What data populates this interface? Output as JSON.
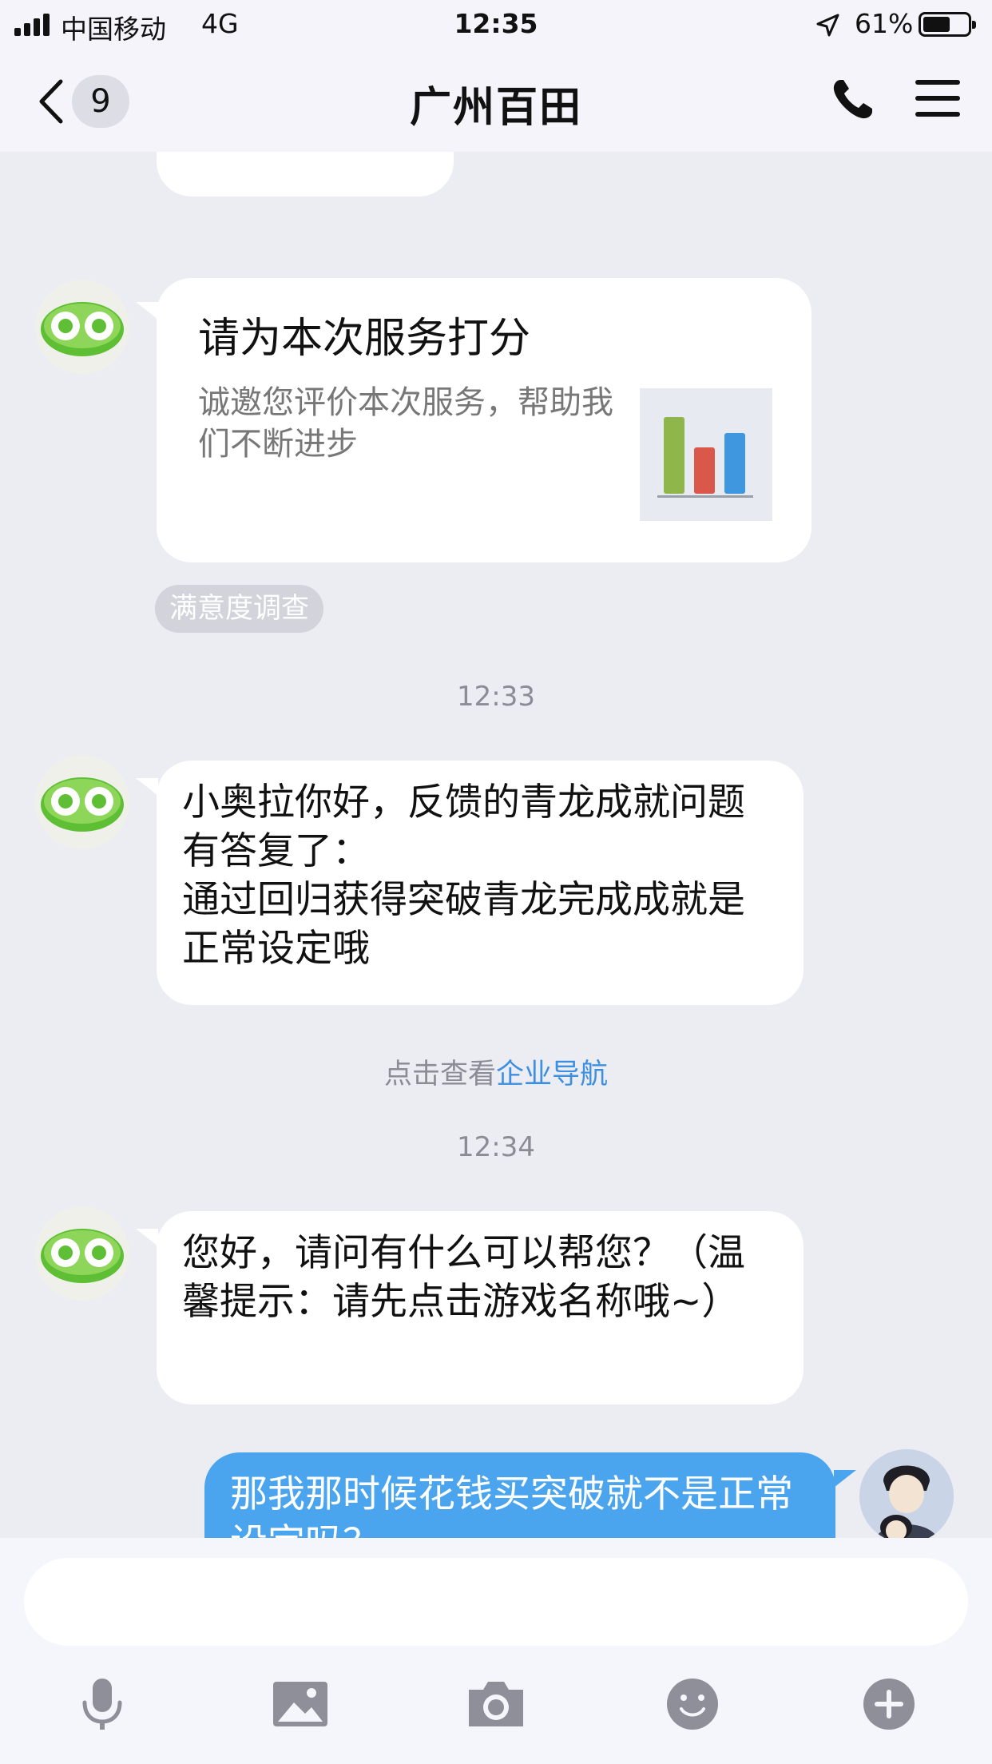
{
  "status_bar": {
    "carrier": "中国移动",
    "network": "4G",
    "time": "12:35",
    "battery_percent": "61%",
    "battery_level": 0.61,
    "signal_bars": 4
  },
  "nav": {
    "unread_count": "9",
    "title": "广州百田",
    "icons": [
      "back-chevron-icon",
      "phone-icon",
      "menu-icon"
    ]
  },
  "messages": {
    "rating_card": {
      "title": "请为本次服务打分",
      "description": "诚邀您评价本次服务，帮助我们不断进步",
      "tag": "满意度调查"
    },
    "time_1": "12:33",
    "msg_1": "小奥拉你好，反馈的青龙成就问题有答复了：\n通过回归获得突破青龙完成成就是正常设定哦",
    "system_prefix": "点击查看",
    "system_link": "企业导航",
    "time_2": "12:34",
    "msg_2": "您好，请问有什么可以帮您？（温馨提示：请先点击游戏名称哦~）",
    "msg_3": "那我那时候花钱买突破就不是正常设定吗？"
  },
  "composer": {
    "placeholder": "",
    "tools": [
      "microphone-icon",
      "image-icon",
      "camera-icon",
      "emoji-icon",
      "plus-icon"
    ]
  },
  "colors": {
    "background": "#ececf3",
    "bubble_self": "#4ba5ee",
    "link": "#3d8fe0"
  }
}
